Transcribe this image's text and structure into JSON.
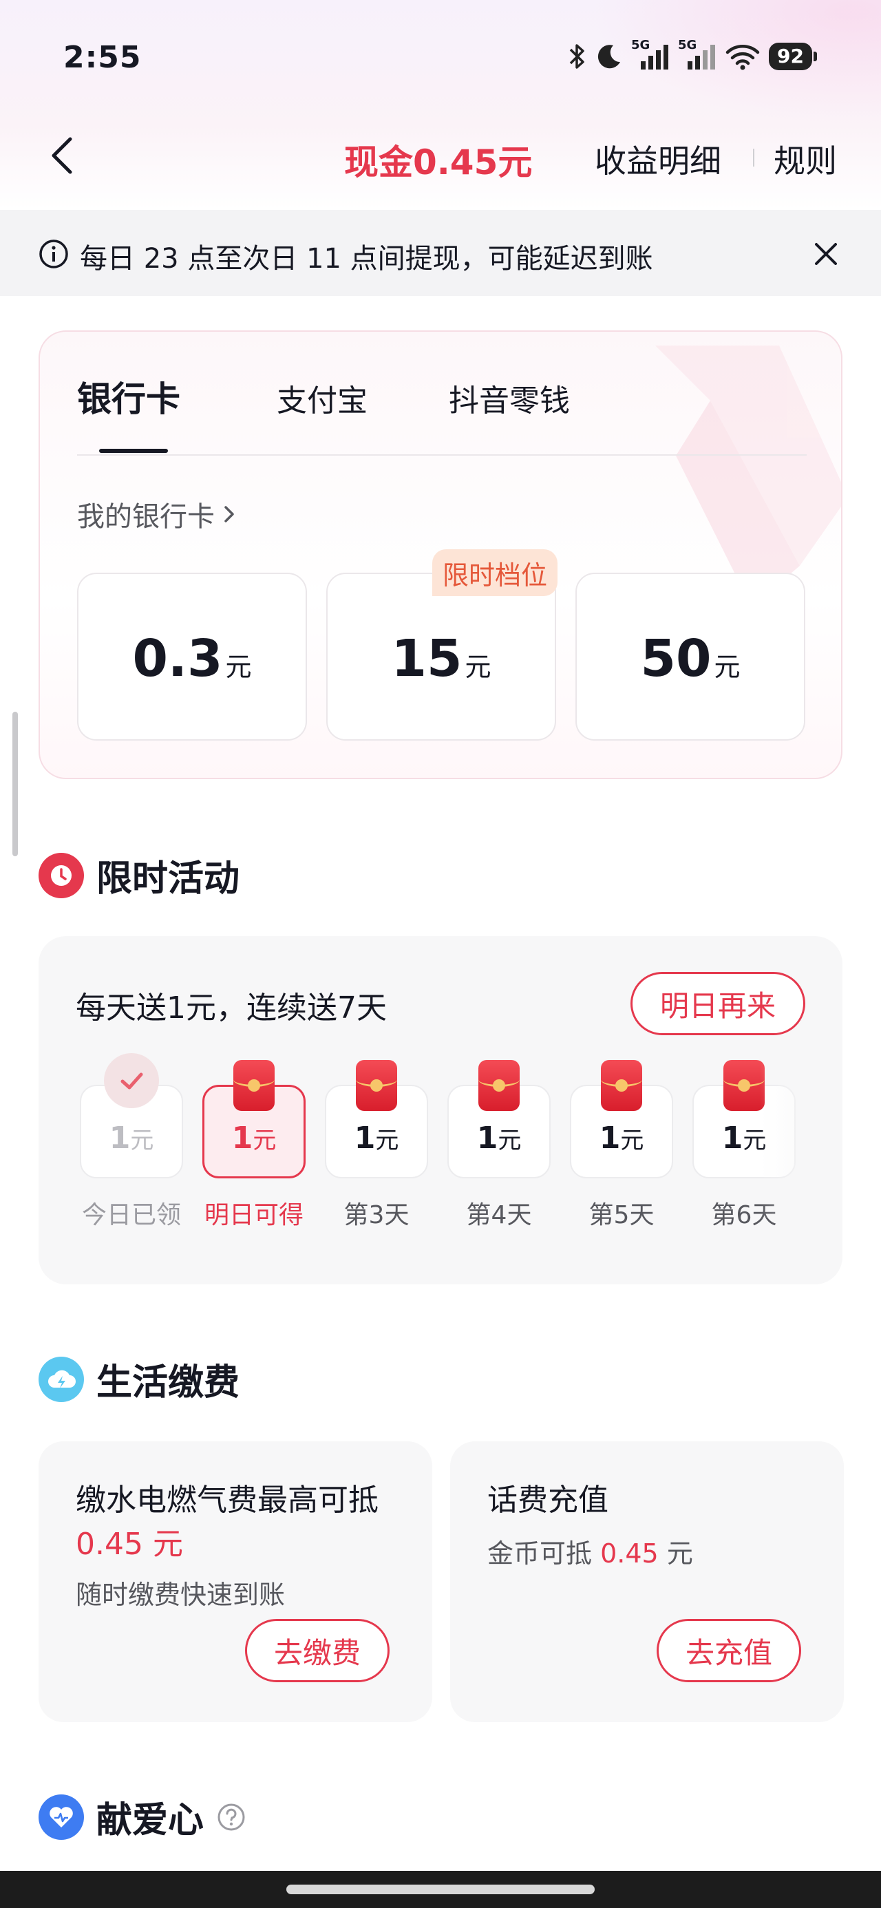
{
  "status_bar": {
    "time": "2:55",
    "battery": "92",
    "network_1": "5G",
    "network_2": "5G"
  },
  "nav": {
    "cash_label": "现金0.45元",
    "detail_link": "收益明细",
    "rules_link": "规则"
  },
  "notice": {
    "text": "每日 23 点至次日 11 点间提现，可能延迟到账"
  },
  "withdraw": {
    "tabs": [
      "银行卡",
      "支付宝",
      "抖音零钱"
    ],
    "active_tab": "银行卡",
    "my_bank_card": "我的银行卡",
    "limited_badge": "限时档位",
    "options": [
      {
        "value": "0.3",
        "unit": "元"
      },
      {
        "value": "15",
        "unit": "元"
      },
      {
        "value": "50",
        "unit": "元"
      }
    ]
  },
  "activity": {
    "section_title": "限时活动",
    "description": "每天送1元，连续送7天",
    "come_back_button": "明日再来",
    "days": [
      {
        "value": "1",
        "unit": "元",
        "label": "今日已领",
        "state": "claimed"
      },
      {
        "value": "1",
        "unit": "元",
        "label": "明日可得",
        "state": "next"
      },
      {
        "value": "1",
        "unit": "元",
        "label": "第3天",
        "state": "upcoming"
      },
      {
        "value": "1",
        "unit": "元",
        "label": "第4天",
        "state": "upcoming"
      },
      {
        "value": "1",
        "unit": "元",
        "label": "第5天",
        "state": "upcoming"
      },
      {
        "value": "1",
        "unit": "元",
        "label": "第6天",
        "state": "upcoming"
      }
    ]
  },
  "bills": {
    "section_title": "生活缴费",
    "utilities": {
      "title_prefix": "缴水电燃气费最高可抵",
      "amount": "0.45 元",
      "subtitle": "随时缴费快速到账",
      "button": "去缴费"
    },
    "phone": {
      "title": "话费充值",
      "subtitle_prefix": "金币可抵",
      "amount": "0.45",
      "subtitle_suffix": "元",
      "button": "去充值"
    }
  },
  "charity": {
    "section_title": "献爱心"
  },
  "colors": {
    "accent": "#e5384d",
    "badge_bg": "#fde4d6",
    "badge_text": "#e5583a",
    "card_bg": "#f7f7f8",
    "activity_icon": "#e5384d",
    "bills_icon": "#5bc8f0",
    "charity_icon": "#3e7cf2"
  }
}
